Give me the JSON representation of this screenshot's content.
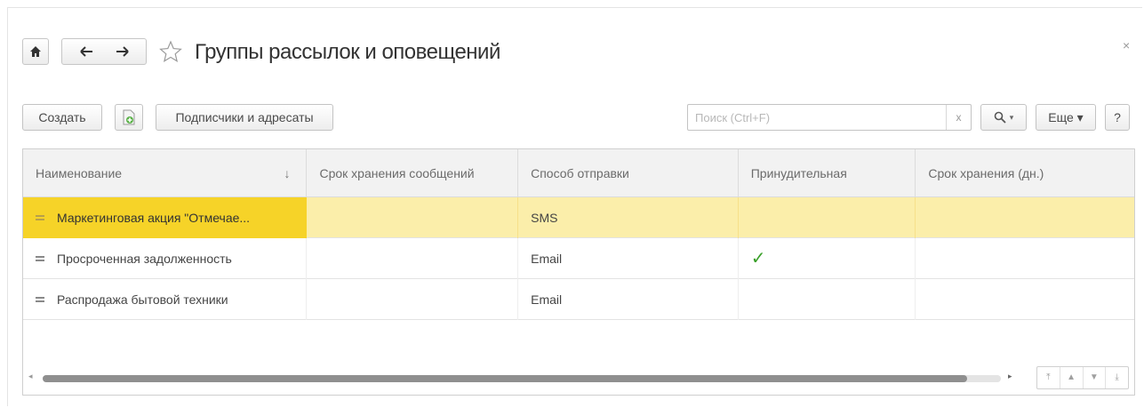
{
  "window": {
    "title": "Группы рассылок и оповещений",
    "close_glyph": "×"
  },
  "icons": {
    "home": "home-icon",
    "back": "arrow-left-icon",
    "forward": "arrow-right-icon",
    "favorite": "star-outline-icon",
    "copy": "copy-document-icon",
    "search": "magnifier-icon"
  },
  "toolbar": {
    "create_label": "Создать",
    "subscribers_label": "Подписчики и адресаты",
    "search_placeholder": "Поиск (Ctrl+F)",
    "search_clear_glyph": "x",
    "find_caret": "▾",
    "more_label": "Еще ▾",
    "help_label": "?"
  },
  "table": {
    "columns": [
      "Наименование",
      "Срок хранения сообщений",
      "Способ отправки",
      "Принудительная",
      "Срок хранения (дн.)"
    ],
    "sort_indicator": "↓",
    "rows": [
      {
        "name": "Маркетинговая акция \"Отмечае...",
        "retention": "",
        "method": "SMS",
        "forced": "",
        "retention_days": "",
        "selected": true
      },
      {
        "name": "Просроченная задолженность",
        "retention": "",
        "method": "Email",
        "forced": "✓",
        "retention_days": "",
        "selected": false
      },
      {
        "name": "Распродажа бытовой техники",
        "retention": "",
        "method": "Email",
        "forced": "",
        "retention_days": "",
        "selected": false
      }
    ]
  },
  "pager": {
    "scroll_left": "◂",
    "scroll_right": "▸",
    "first": "⤒",
    "prev": "▲",
    "next": "▼",
    "last": "⤓"
  },
  "colors": {
    "selected_row": "#fbeeaa",
    "selected_cell": "#f6d328",
    "check": "#3aa02a"
  }
}
